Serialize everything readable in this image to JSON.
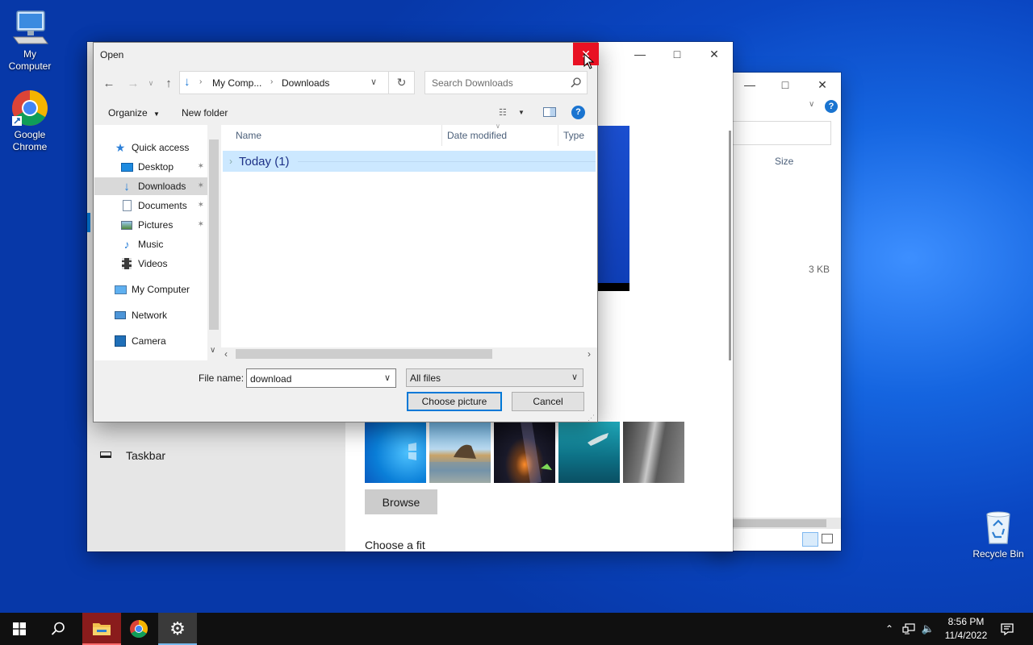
{
  "desktop": {
    "icons": [
      {
        "label_line1": "My",
        "label_line2": "Computer"
      },
      {
        "label_line1": "Google",
        "label_line2": "Chrome"
      },
      {
        "label_line1": "Recycle Bin",
        "label_line2": ""
      }
    ]
  },
  "explorer_bg": {
    "column_size": "Size",
    "file_size": "3 KB"
  },
  "settings": {
    "taskbar_label": "Taskbar",
    "browse_label": "Browse",
    "choose_fit_label": "Choose a fit"
  },
  "dialog": {
    "title": "Open",
    "breadcrumb": [
      "My Comp...",
      "Downloads"
    ],
    "search_placeholder": "Search Downloads",
    "organize_label": "Organize",
    "new_folder_label": "New folder",
    "nav_items": [
      {
        "label": "Quick access",
        "icon": "star-icon"
      },
      {
        "label": "Desktop",
        "icon": "desktop-icon",
        "pinned": true
      },
      {
        "label": "Downloads",
        "icon": "download-arrow-icon",
        "pinned": true,
        "selected": true
      },
      {
        "label": "Documents",
        "icon": "document-icon",
        "pinned": true
      },
      {
        "label": "Pictures",
        "icon": "pictures-icon",
        "pinned": true
      },
      {
        "label": "Music",
        "icon": "music-icon"
      },
      {
        "label": "Videos",
        "icon": "video-icon"
      },
      {
        "label": "My Computer",
        "icon": "computer-icon"
      },
      {
        "label": "Network",
        "icon": "network-icon"
      },
      {
        "label": "Camera",
        "icon": "camera-icon"
      }
    ],
    "columns": [
      "Name",
      "Date modified",
      "Type"
    ],
    "group_label": "Today (1)",
    "file_name_label": "File name:",
    "file_name_value": "download",
    "file_type_value": "All files",
    "choose_label": "Choose picture",
    "cancel_label": "Cancel"
  },
  "taskbar": {
    "time": "8:56 PM",
    "date": "11/4/2022"
  },
  "colors": {
    "accent": "#0078d7",
    "selection": "#cce8ff",
    "close_hover": "#e81123"
  }
}
